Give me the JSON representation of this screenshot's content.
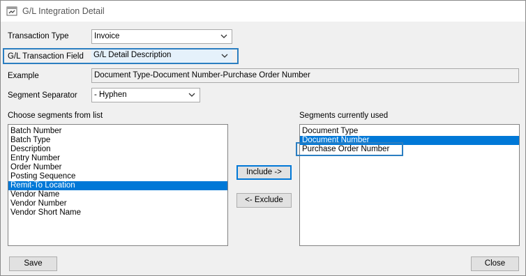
{
  "window": {
    "title": "G/L Integration Detail"
  },
  "form": {
    "transaction_type_label": "Transaction Type",
    "transaction_type_value": "Invoice",
    "gl_field_label": "G/L Transaction Field",
    "gl_field_value": "G/L Detail Description",
    "example_label": "Example",
    "example_value": "Document Type-Document Number-Purchase Order Number",
    "separator_label": "Segment Separator",
    "separator_value": "- Hyphen"
  },
  "available": {
    "label": "Choose segments from list",
    "items": [
      "Batch Number",
      "Batch Type",
      "Description",
      "Entry Number",
      "Order Number",
      "Posting Sequence",
      "Remit-To Location",
      "Vendor Name",
      "Vendor Number",
      "Vendor Short Name"
    ],
    "selected": "Remit-To Location"
  },
  "used": {
    "label": "Segments currently used",
    "items": [
      "Document Type",
      "Document Number",
      "Purchase Order Number"
    ],
    "selected": "Document Number"
  },
  "buttons": {
    "include": "Include ->",
    "exclude": "<- Exclude",
    "save": "Save",
    "close": "Close"
  },
  "colors": {
    "highlight_box": "#2b7ec1",
    "selection": "#0078d7"
  }
}
